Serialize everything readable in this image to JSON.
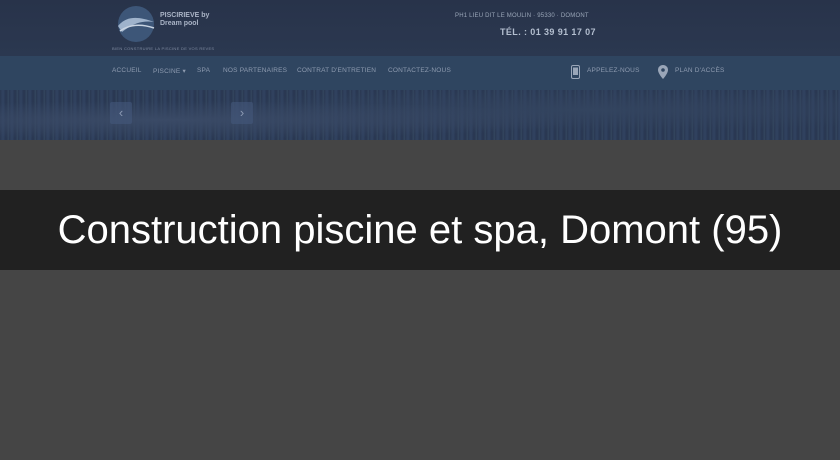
{
  "site": {
    "logo": {
      "name_line1": "PISCIRIEVE by",
      "name_line2": "Dream pool",
      "tagline": "BIEN CONSTRUIRE LA PISCINE DE VOS REVES"
    },
    "address": "PH1 LIEU DIT LE MOULIN · 95330 · DOMONT",
    "phone": "TÉL. : 01 39 91 17 07",
    "nav": {
      "items": [
        {
          "label": "ACCUEIL"
        },
        {
          "label": "PISCINE"
        },
        {
          "label": "SPA"
        },
        {
          "label": "NOS PARTENAIRES"
        },
        {
          "label": "CONTRAT D'ENTRETIEN"
        },
        {
          "label": "CONTACTEZ-NOUS"
        }
      ],
      "call_label": "APPELEZ-NOUS",
      "map_label": "PLAN D'ACCÈS"
    },
    "slider": {
      "prev_glyph": "‹",
      "next_glyph": "›"
    }
  },
  "banner": {
    "title": "Construction piscine et spa, Domont (95)"
  },
  "colors": {
    "overlay": "#454545",
    "banner_bg": "#212121",
    "banner_text": "#ffffff",
    "header_bg": "#28334a",
    "nav_bg": "#2f4560"
  }
}
